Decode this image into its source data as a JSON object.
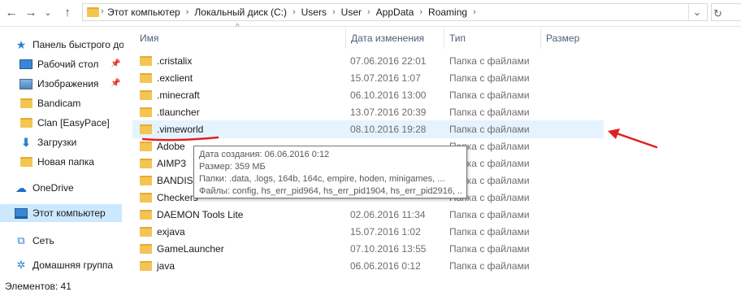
{
  "nav": {
    "back": "←",
    "forward": "→",
    "dropdown": "⌄",
    "up": "↑"
  },
  "breadcrumbs": [
    "Этот компьютер",
    "Локальный диск (C:)",
    "Users",
    "User",
    "AppData",
    "Roaming"
  ],
  "breadcrumb_separator": "›",
  "sidebar": {
    "quick_access": "Панель быстрого до",
    "items": [
      "Рабочий стол",
      "Изображения",
      "Bandicam",
      "Clan [EasyPace]",
      "Загрузки",
      "Новая папка"
    ],
    "onedrive": "OneDrive",
    "this_pc": "Этот компьютер",
    "network": "Сеть",
    "homegroup": "Домашняя группа"
  },
  "columns": {
    "name": "Имя",
    "date": "Дата изменения",
    "type": "Тип",
    "size": "Размер"
  },
  "rows": [
    {
      "name": ".cristalix",
      "date": "07.06.2016 22:01",
      "type": "Папка с файлами"
    },
    {
      "name": ".exclient",
      "date": "15.07.2016 1:07",
      "type": "Папка с файлами"
    },
    {
      "name": ".minecraft",
      "date": "06.10.2016 13:00",
      "type": "Папка с файлами"
    },
    {
      "name": ".tlauncher",
      "date": "13.07.2016 20:39",
      "type": "Папка с файлами"
    },
    {
      "name": ".vimeworld",
      "date": "08.10.2016 19:28",
      "type": "Папка с файлами"
    },
    {
      "name": "Adobe",
      "date": "",
      "type": "Папка с файлами"
    },
    {
      "name": "AIMP3",
      "date": "",
      "type": "Папка с файлами"
    },
    {
      "name": "BANDISO",
      "date": "",
      "type": "Папка с файлами"
    },
    {
      "name": "Checkers",
      "date": "",
      "type": "Папка с файлами"
    },
    {
      "name": "DAEMON Tools Lite",
      "date": "02.06.2016 11:34",
      "type": "Папка с файлами"
    },
    {
      "name": "exjava",
      "date": "15.07.2016 1:02",
      "type": "Папка с файлами"
    },
    {
      "name": "GameLauncher",
      "date": "07.10.2016 13:55",
      "type": "Папка с файлами"
    },
    {
      "name": "java",
      "date": "06.06.2016 0:12",
      "type": "Папка с файлами"
    }
  ],
  "tooltip": {
    "created": "Дата создания: 06.06.2016 0:12",
    "size": "Размер: 359 МБ",
    "folders": "Папки: .data, .logs, 164b, 164c, empire, hoden, minigames, ...",
    "files": "Файлы: config, hs_err_pid964, hs_err_pid1904, hs_err_pid2916, ..."
  },
  "status": "Элементов: 41",
  "colors": {
    "annotation": "#e02020",
    "selected": "#cce8ff",
    "hover": "#e5f3ff",
    "folder": "#f3c552"
  }
}
